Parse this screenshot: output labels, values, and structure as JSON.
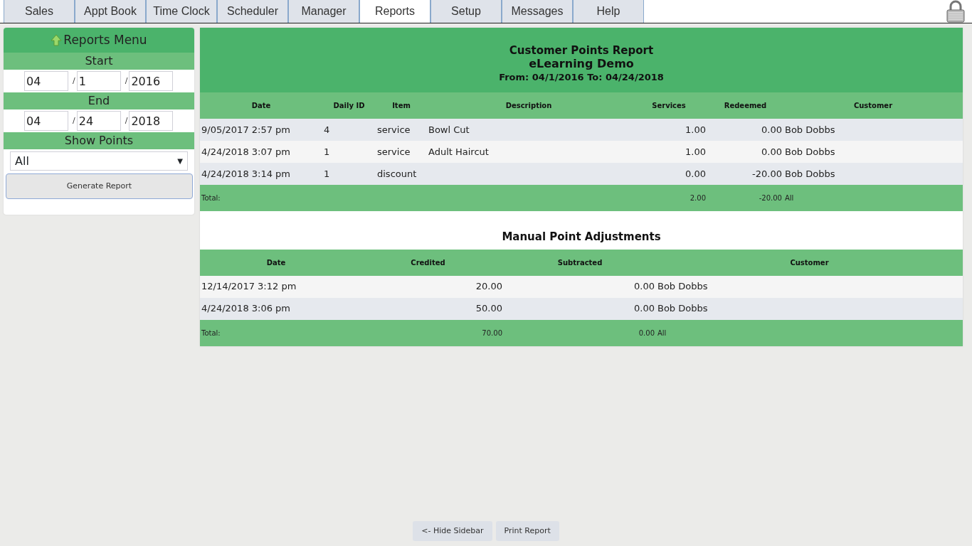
{
  "tabs": [
    {
      "label": "Sales",
      "selected": false
    },
    {
      "label": "Appt Book",
      "selected": false
    },
    {
      "label": "Time Clock",
      "selected": false
    },
    {
      "label": "Scheduler",
      "selected": false
    },
    {
      "label": "Manager",
      "selected": false
    },
    {
      "label": "Reports",
      "selected": true
    },
    {
      "label": "Setup",
      "selected": false
    },
    {
      "label": "Messages",
      "selected": false
    },
    {
      "label": "Help",
      "selected": false
    }
  ],
  "sidebar": {
    "title": "Reports Menu",
    "start_label": "Start",
    "start_fields": [
      {
        "value": "04"
      },
      {
        "prefix": "/",
        "value": "1"
      },
      {
        "prefix": "/",
        "value": "2016"
      }
    ],
    "end_label": "End",
    "end_fields": [
      {
        "value": "04"
      },
      {
        "prefix": "/",
        "value": "24"
      },
      {
        "prefix": "/",
        "value": "2018"
      }
    ],
    "show_points_label": "Show Points",
    "show_points_value": "All",
    "select_arrow": "▼",
    "generate_button": "Generate Report"
  },
  "report": {
    "title": "Customer Points Report",
    "subtitle": "eLearning Demo",
    "range": "From: 04/1/2016 To: 04/24/2018",
    "columns": {
      "date": "Date",
      "daily_id": "Daily ID",
      "item": "Item",
      "description": "Description",
      "services": "Services",
      "redeemed": "Redeemed",
      "customer": "Customer"
    },
    "rows": [
      {
        "date": "9/05/2017 2:57 pm",
        "daily_id": "4",
        "item": "service",
        "description": "Bowl Cut",
        "services": "1.00",
        "redeemed": "0.00",
        "customer": "Bob Dobbs"
      },
      {
        "date": "4/24/2018 3:07 pm",
        "daily_id": "1",
        "item": "service",
        "description": "Adult Haircut",
        "services": "1.00",
        "redeemed": "0.00",
        "customer": "Bob Dobbs"
      },
      {
        "date": "4/24/2018 3:14 pm",
        "daily_id": "1",
        "item": "discount",
        "services": "0.00",
        "redeemed": "-20.00",
        "customer": "Bob Dobbs"
      }
    ],
    "total": {
      "date": "Total:",
      "services": "2.00",
      "redeemed": "-20.00",
      "customer": "All"
    }
  },
  "adjustments": {
    "title": "Manual Point Adjustments",
    "columns": {
      "date": "Date",
      "credited": "Credited",
      "subtracted": "Subtracted",
      "customer": "Customer"
    },
    "rows": [
      {
        "date": "12/14/2017 3:12 pm",
        "credited": "20.00",
        "subtracted": "0.00",
        "customer": "Bob Dobbs"
      },
      {
        "date": "4/24/2018 3:06 pm",
        "credited": "50.00",
        "subtracted": "0.00",
        "customer": "Bob Dobbs"
      }
    ],
    "total": {
      "date": "Total:",
      "credited": "70.00",
      "subtracted": "0.00",
      "customer": "All"
    }
  },
  "footer_buttons": [
    "<- Hide Sidebar",
    "Print Report"
  ]
}
